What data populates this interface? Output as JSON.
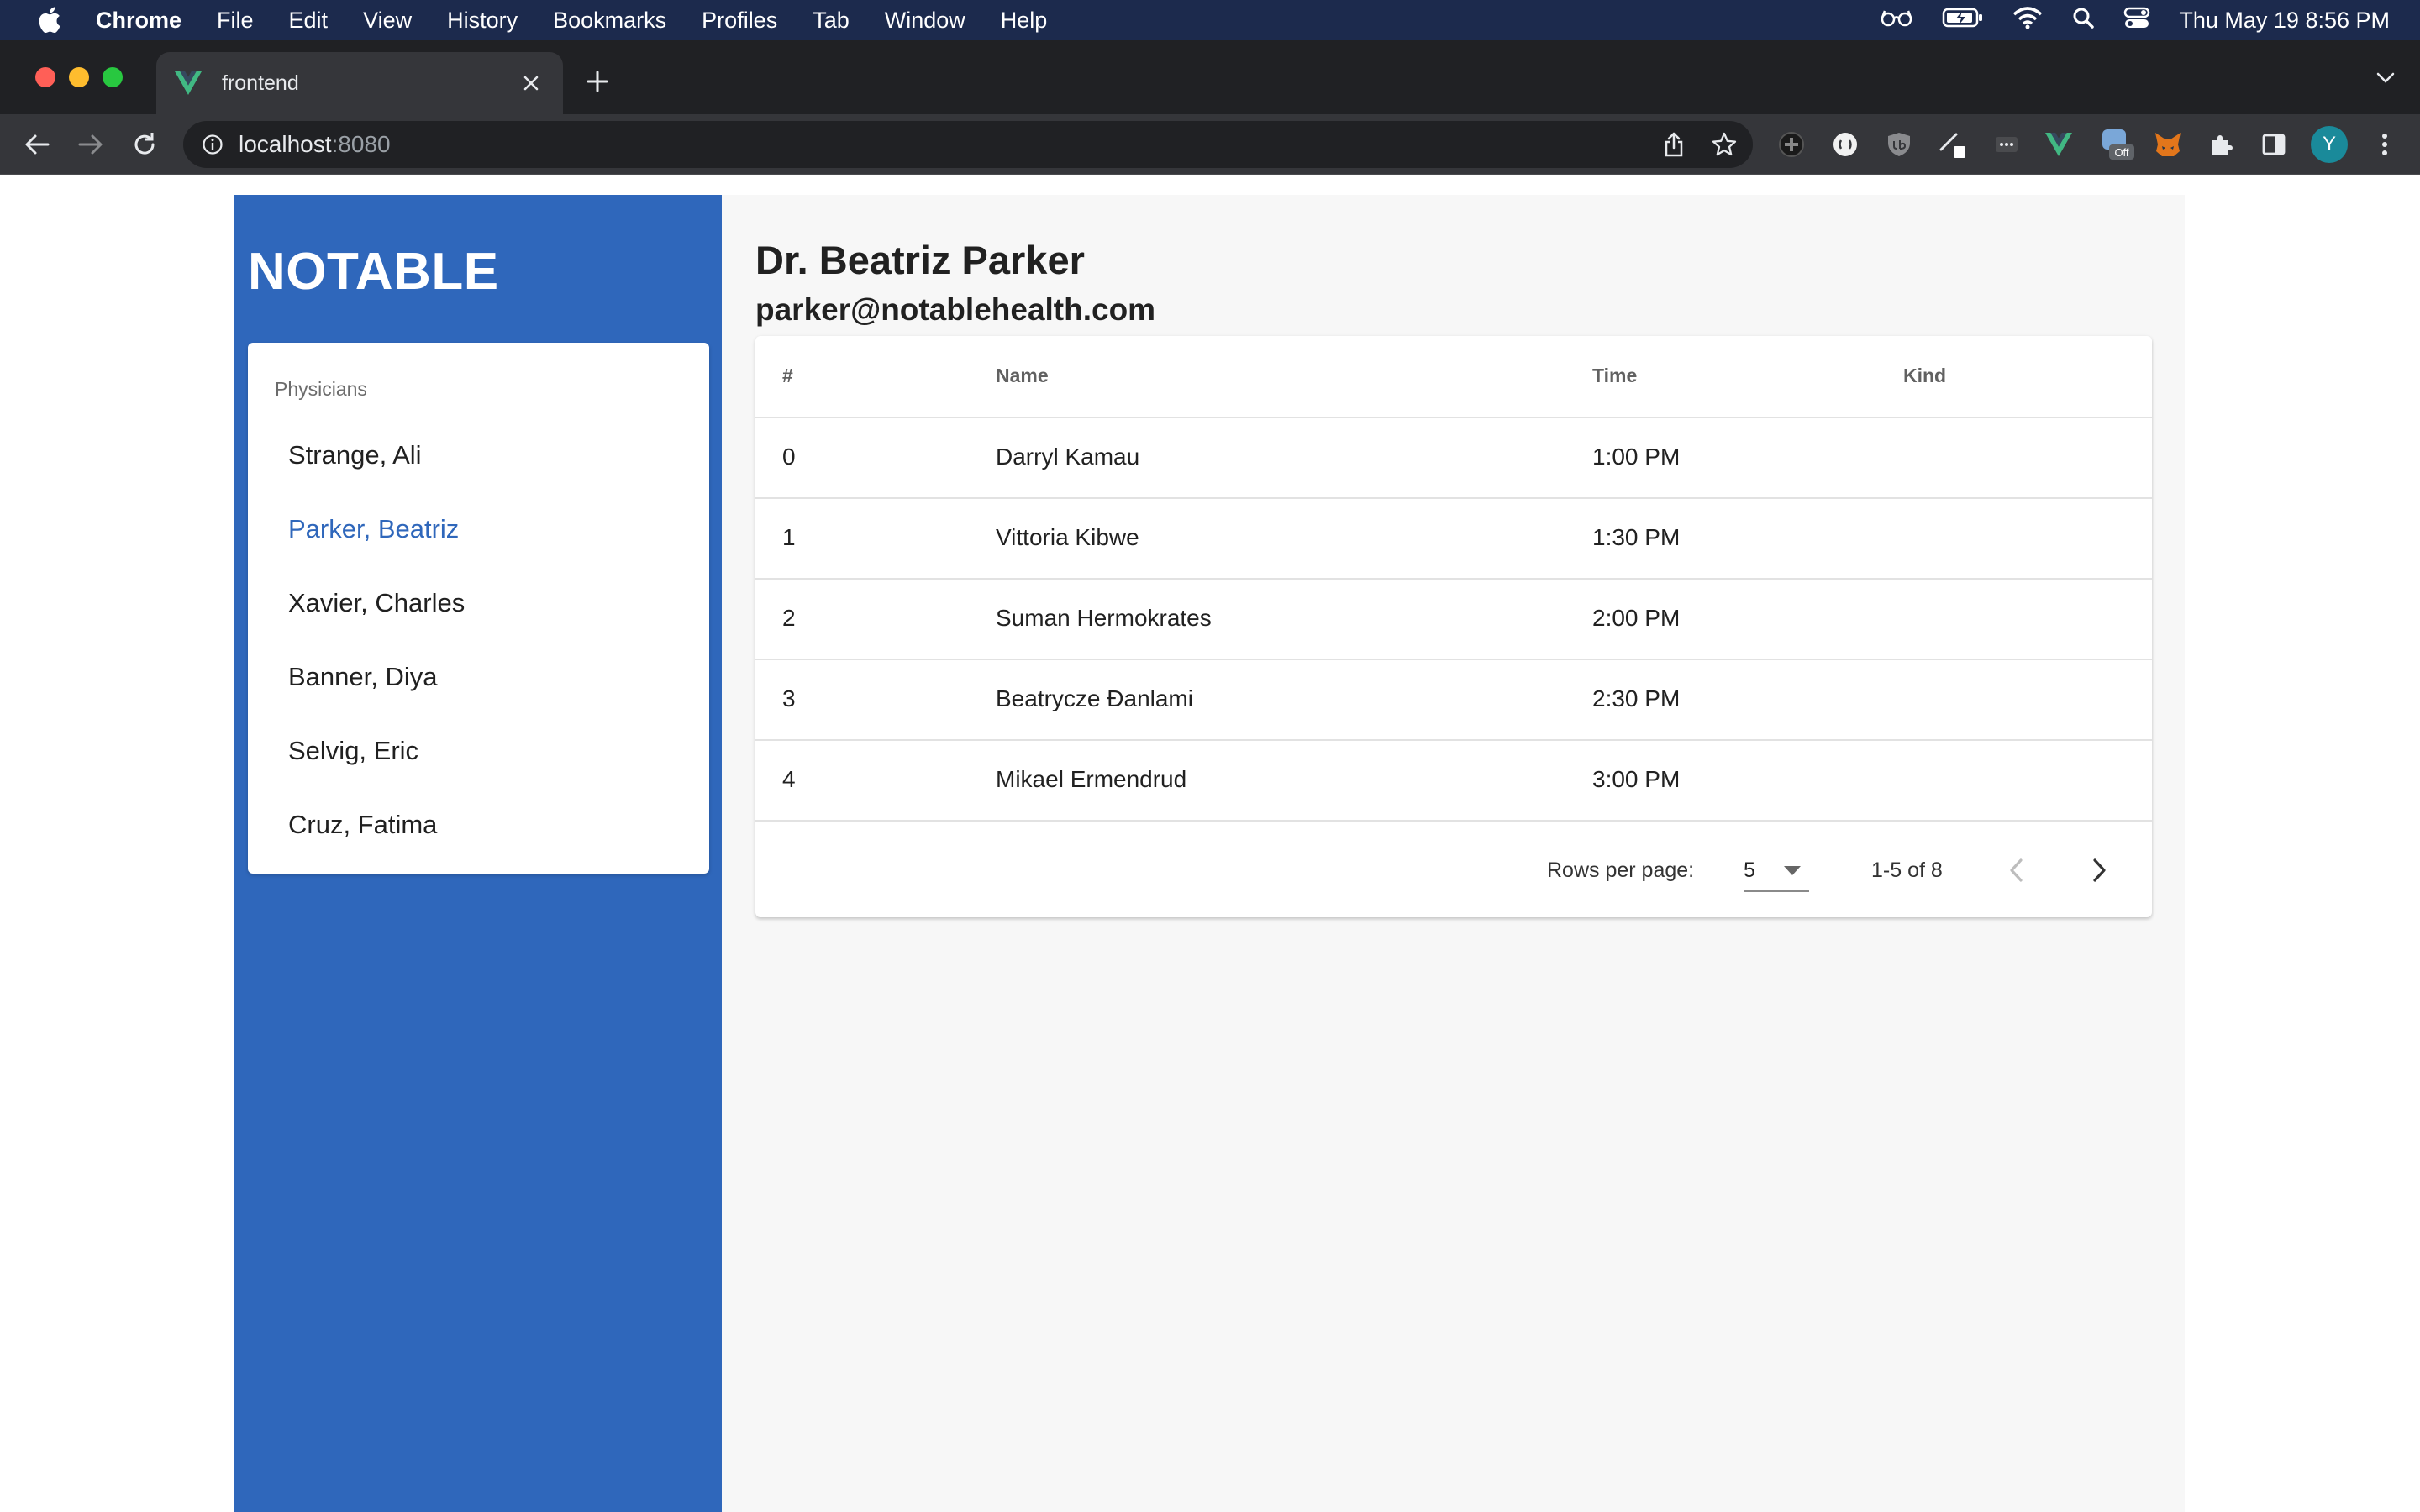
{
  "menubar": {
    "app_name": "Chrome",
    "items": [
      "File",
      "Edit",
      "View",
      "History",
      "Bookmarks",
      "Profiles",
      "Tab",
      "Window",
      "Help"
    ],
    "clock": "Thu May 19  8:56 PM"
  },
  "browser": {
    "tab_title": "frontend",
    "url_host": "localhost",
    "url_port": ":8080",
    "profile_initial": "Y",
    "extension_badge": "Off"
  },
  "app": {
    "brand": "NOTABLE",
    "physicians_header": "Physicians",
    "physicians": [
      "Strange, Ali",
      "Parker, Beatriz",
      "Xavier, Charles",
      "Banner, Diya",
      "Selvig, Eric",
      "Cruz, Fatima"
    ],
    "selected_physician": "Parker, Beatriz",
    "doctor_name": "Dr. Beatriz Parker",
    "doctor_email": "parker@notablehealth.com",
    "table": {
      "columns": [
        "#",
        "Name",
        "Time",
        "Kind"
      ],
      "rows": [
        {
          "num": "0",
          "name": "Darryl Kamau",
          "time": "1:00 PM",
          "kind": ""
        },
        {
          "num": "1",
          "name": "Vittoria Kibwe",
          "time": "1:30 PM",
          "kind": ""
        },
        {
          "num": "2",
          "name": "Suman Hermokrates",
          "time": "2:00 PM",
          "kind": ""
        },
        {
          "num": "3",
          "name": "Beatrycze Ðanlami",
          "time": "2:30 PM",
          "kind": ""
        },
        {
          "num": "4",
          "name": "Mikael Ermendrud",
          "time": "3:00 PM",
          "kind": ""
        }
      ],
      "rows_per_page_label": "Rows per page:",
      "rows_per_page": "5",
      "range": "1-5 of 8"
    }
  },
  "colors": {
    "sidebar": "#2f67bb",
    "accent": "#2f67bb",
    "menubar": "#1c2a4d",
    "chrome_dark": "#202124",
    "chrome_toolbar": "#35363a"
  }
}
